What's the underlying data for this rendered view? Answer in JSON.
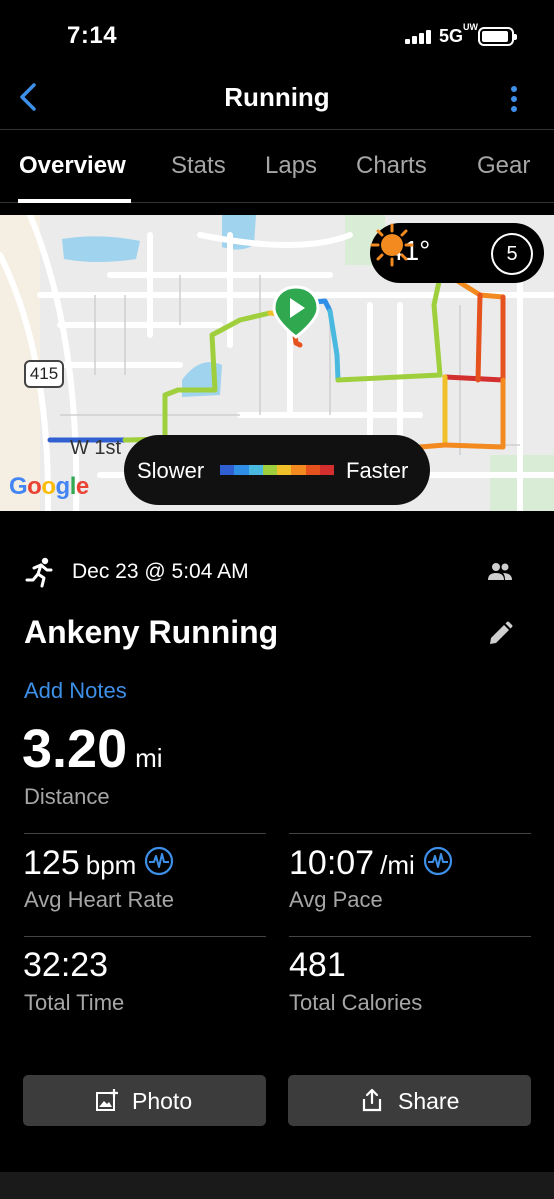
{
  "status_bar": {
    "time": "7:14",
    "network": "5G",
    "network_sup": "UW"
  },
  "header": {
    "title": "Running"
  },
  "tabs": [
    {
      "label": "Overview",
      "active": true
    },
    {
      "label": "Stats"
    },
    {
      "label": "Laps"
    },
    {
      "label": "Charts"
    },
    {
      "label": "Gear"
    }
  ],
  "map": {
    "temperature": "41°",
    "moon_phase": "5",
    "road_shield": "415",
    "street_label": "W 1st",
    "attribution": "Google",
    "legend": {
      "slower": "Slower",
      "faster": "Faster"
    },
    "pace_colors": [
      "#2f5fd0",
      "#2f8fe6",
      "#4ab9e0",
      "#9fcf3c",
      "#f0c02a",
      "#f28a20",
      "#e5521e",
      "#d32f2f"
    ]
  },
  "activity": {
    "icon": "running-icon",
    "date": "Dec 23 @ 5:04 AM",
    "title": "Ankeny Running",
    "add_notes": "Add Notes",
    "distance": {
      "value": "3.20",
      "unit": "mi",
      "label": "Distance"
    }
  },
  "stats": {
    "heart_rate": {
      "value": "125",
      "unit": "bpm",
      "label": "Avg Heart Rate"
    },
    "pace": {
      "value": "10:07",
      "unit": "/mi",
      "label": "Avg Pace"
    },
    "time": {
      "value": "32:23",
      "label": "Total Time"
    },
    "calories": {
      "value": "481",
      "label": "Total Calories"
    }
  },
  "buttons": {
    "photo": "Photo",
    "share": "Share"
  },
  "colors": {
    "accent": "#3d8fe8",
    "background": "#000000",
    "button": "#3c3c3c"
  }
}
